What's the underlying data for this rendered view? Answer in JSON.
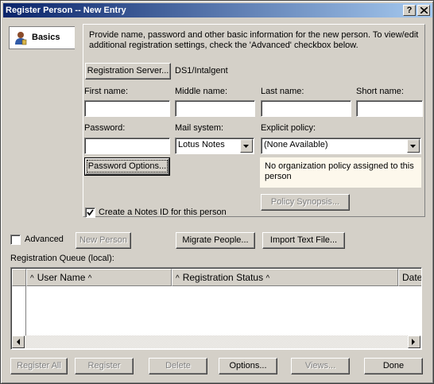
{
  "window": {
    "title": "Register Person -- New Entry",
    "help_glyph": "?",
    "close_glyph": "✕"
  },
  "tab": {
    "label": "Basics"
  },
  "intro_text": "Provide name, password and other basic information for the new person.  To view/edit additional registration settings, check the 'Advanced' checkbox below.",
  "registration_server": {
    "button_label": "Registration Server...",
    "value": "DS1/Intalgent"
  },
  "fields": {
    "first_name": {
      "label": "First name:",
      "value": ""
    },
    "middle_name": {
      "label": "Middle name:",
      "value": ""
    },
    "last_name": {
      "label": "Last name:",
      "value": ""
    },
    "short_name": {
      "label": "Short name:",
      "value": ""
    },
    "password": {
      "label": "Password:",
      "value": ""
    },
    "mail_system": {
      "label": "Mail system:",
      "value": "Lotus Notes"
    },
    "explicit_policy": {
      "label": "Explicit policy:",
      "value": "(None Available)"
    }
  },
  "password_options_label": "Password Options...",
  "policy_message": "No organization policy assigned to this person",
  "policy_synopsis_label": "Policy Synopsis...",
  "create_notes_id": {
    "label": "Create a Notes ID for this person",
    "checked": true,
    "checkmark": "✔"
  },
  "advanced": {
    "label": "Advanced",
    "checked": false
  },
  "buttons": {
    "new_person": "New Person",
    "migrate_people": "Migrate People...",
    "import_text_file": "Import Text File...",
    "register_all": "Register All",
    "register": "Register",
    "delete": "Delete",
    "options": "Options...",
    "views": "Views...",
    "done": "Done"
  },
  "queue": {
    "label": "Registration Queue (local):",
    "columns": [
      "User Name",
      "Registration Status",
      "Date"
    ],
    "sort_glyph": "^",
    "rows": []
  }
}
